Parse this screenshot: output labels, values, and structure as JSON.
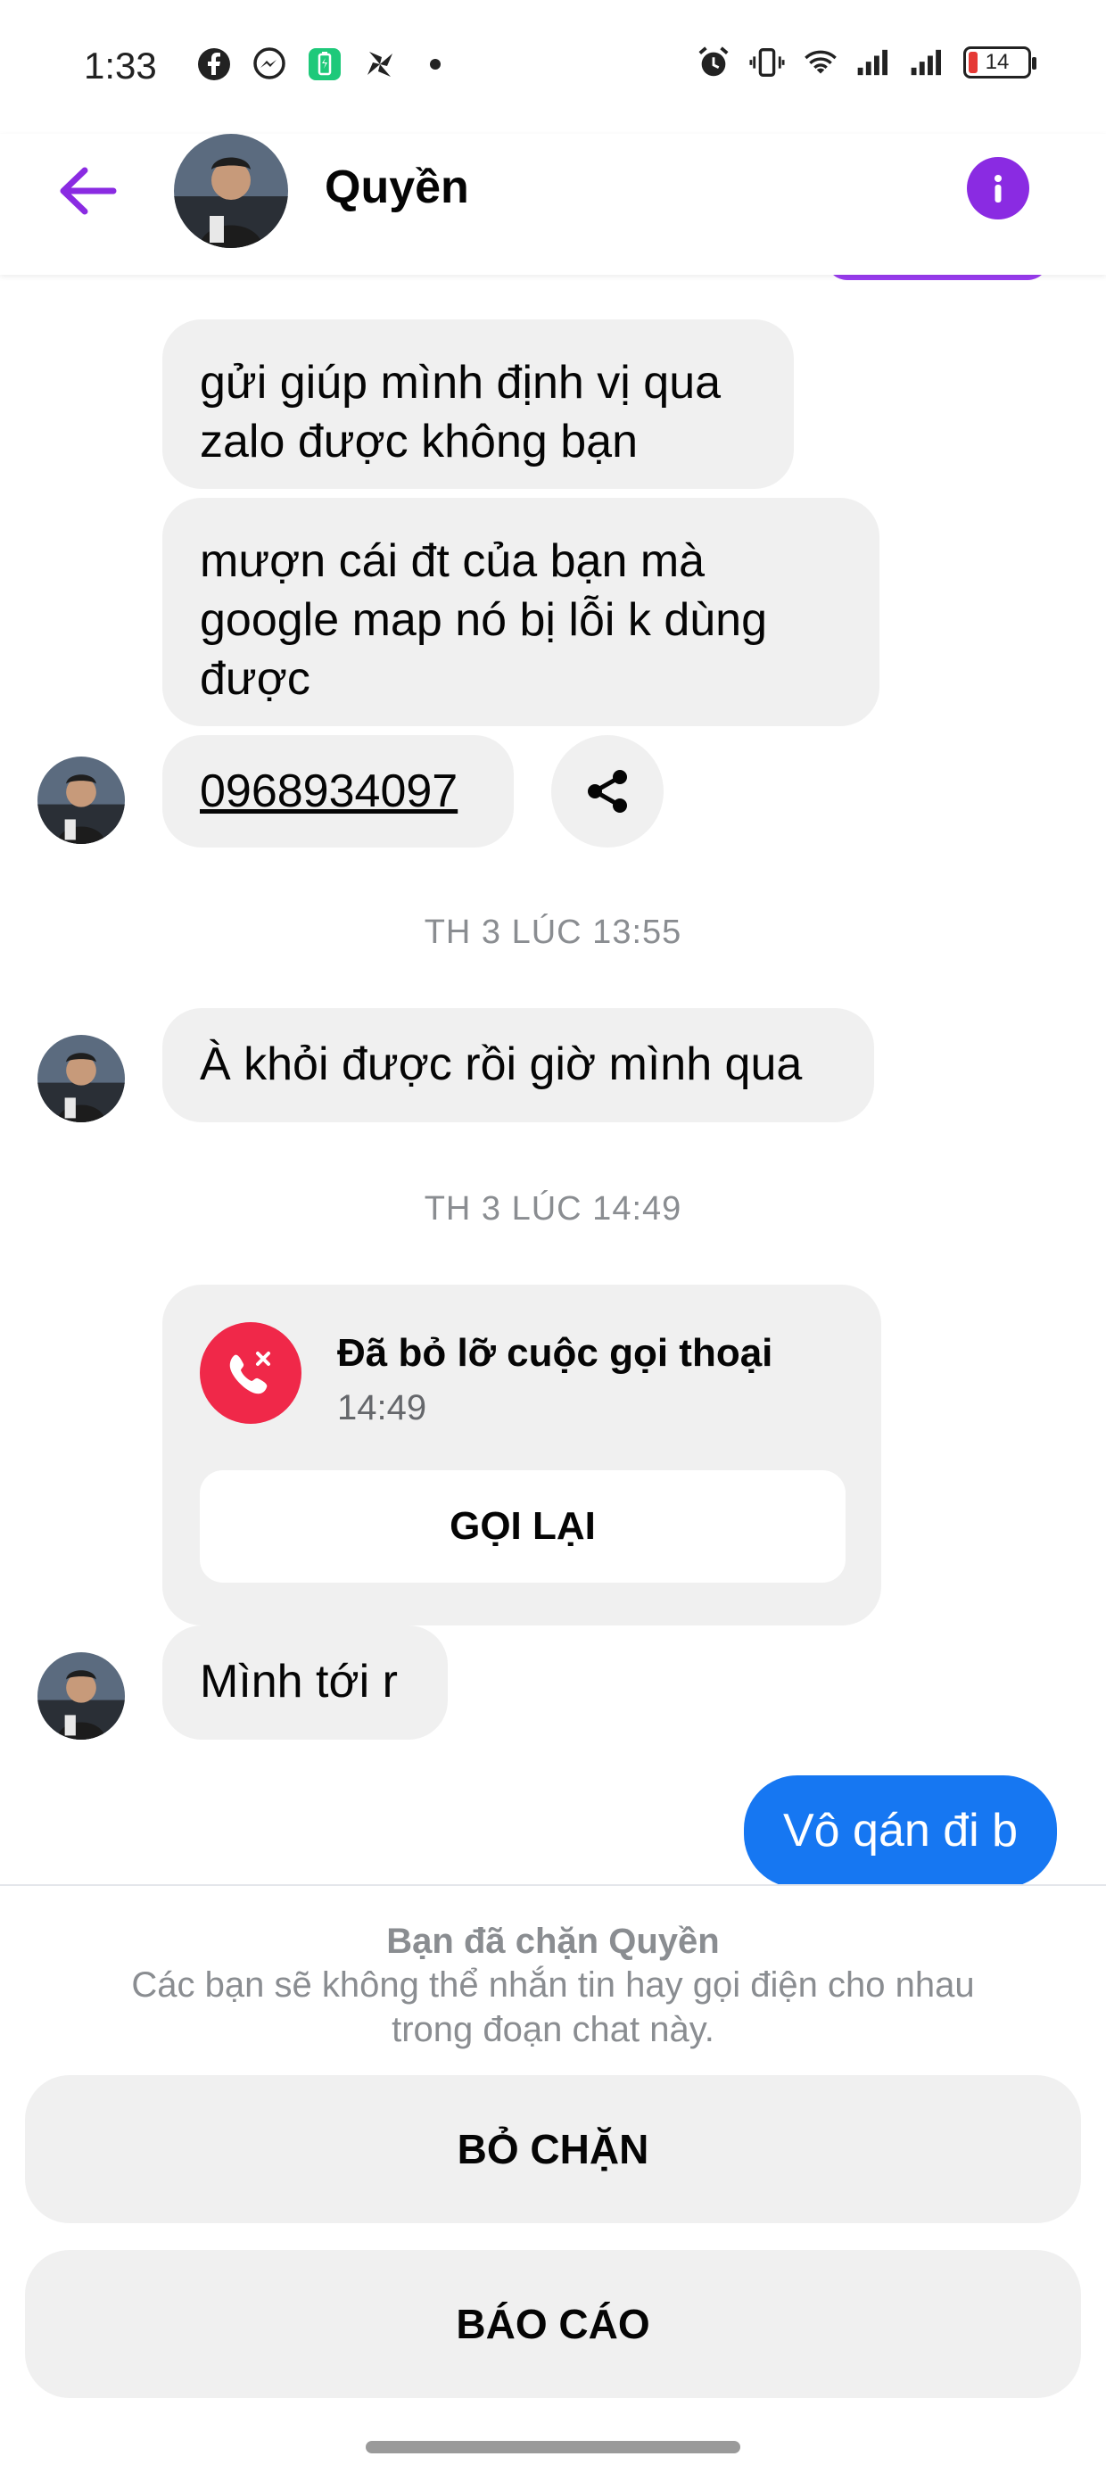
{
  "status_bar": {
    "time": "1:33",
    "battery_level": "14",
    "left_icons": [
      "facebook-icon",
      "messenger-icon",
      "battery-saver-icon",
      "pinwheel-icon",
      "dot-icon"
    ],
    "right_icons": [
      "alarm-icon",
      "vibrate-icon",
      "wifi-icon",
      "signal-icon",
      "signal-icon"
    ]
  },
  "header": {
    "contact_name": "Quyền",
    "back_icon": "arrow-left-icon",
    "info_icon": "info-icon",
    "accent_color": "#8a2be2"
  },
  "messages": {
    "m1": "gửi giúp mình định vị qua zalo được không bạn",
    "m2": "mượn cái đt của bạn mà google map nó bị lỗi k dùng được",
    "phone": "0968934097",
    "ts1": "TH 3 LÚC 13:55",
    "m3": "À khỏi được rồi giờ mình qua",
    "ts2": "TH 3 LÚC 14:49",
    "missed_call_title": "Đã bỏ lỡ cuộc gọi thoại",
    "missed_call_time": "14:49",
    "call_back_label": "GỌI LẠI",
    "m4": "Mình tới r",
    "sent1": "Vô qán đi b",
    "sent_color": "#1677f2"
  },
  "blocked_panel": {
    "title": "Bạn đã chặn Quyền",
    "description": "Các bạn sẽ không thể nhắn tin hay gọi điện cho nhau trong đoạn chat này.",
    "unblock_label": "BỎ CHẶN",
    "report_label": "BÁO CÁO"
  }
}
